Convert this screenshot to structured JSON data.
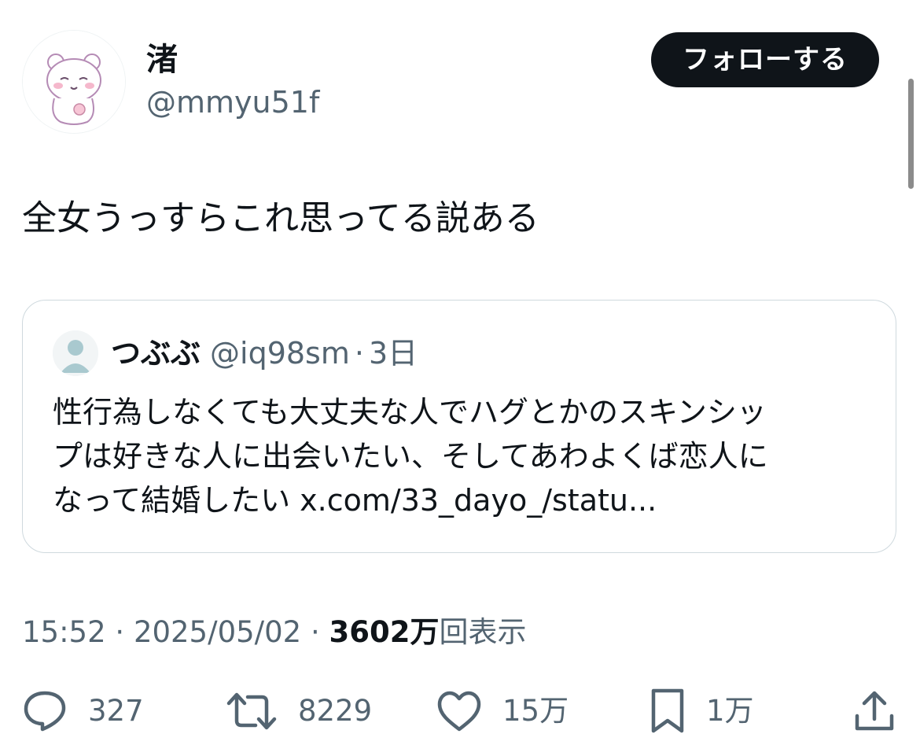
{
  "author": {
    "display_name": "渚",
    "handle": "@mmyu51f"
  },
  "follow_button": {
    "label": "フォローする"
  },
  "tweet": {
    "text": "全女うっすらこれ思ってる説ある"
  },
  "quoted_tweet": {
    "display_name": "つぶぶ",
    "handle": "@iq98sm",
    "separator": "·",
    "time": "3日",
    "lines": [
      "性行為しなくても大丈夫な人でハグとかのスキンシッ",
      "プは好きな人に出会いたい、そしてあわよくば恋人に",
      "なって結婚したい x.com/33_dayo_/statu..."
    ]
  },
  "meta": {
    "time": "15:52",
    "sep1": "·",
    "date": "2025/05/02",
    "sep2": "·",
    "views_count": "3602万",
    "views_label": "回表示"
  },
  "actions": {
    "reply_count": "327",
    "repost_count": "8229",
    "like_count": "15万",
    "bookmark_count": "1万"
  },
  "icons": {
    "reply": "reply-icon",
    "repost": "repost-icon",
    "like": "heart-icon",
    "bookmark": "bookmark-icon",
    "share": "share-icon"
  },
  "colors": {
    "text_primary": "#0f1419",
    "text_secondary": "#536471",
    "border": "#cfd9de",
    "follow_bg": "#0f1419",
    "follow_text": "#ffffff"
  }
}
